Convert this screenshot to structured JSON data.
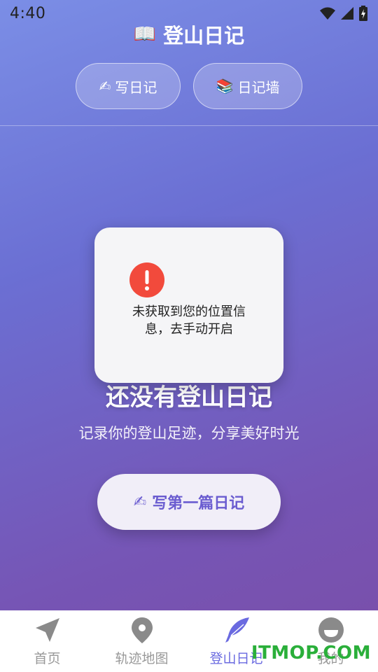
{
  "status_bar": {
    "time": "4:40"
  },
  "header": {
    "title": "登山日记",
    "tabs": [
      {
        "icon": "✍",
        "label": "写日记"
      },
      {
        "icon": "📚",
        "label": "日记墙"
      }
    ]
  },
  "dialog": {
    "message": "未获取到您的位置信息，去手动开启"
  },
  "empty_state": {
    "title": "还没有登山日记",
    "subtitle": "记录你的登山足迹，分享美好时光",
    "cta_icon": "✍",
    "cta_label": "写第一篇日记"
  },
  "bottom_nav": {
    "items": [
      {
        "label": "首页",
        "icon": "navigation-arrow-icon",
        "active": false
      },
      {
        "label": "轨迹地图",
        "icon": "map-pin-icon",
        "active": false
      },
      {
        "label": "登山日记",
        "icon": "feather-icon",
        "active": true
      },
      {
        "label": "我的",
        "icon": "profile-icon",
        "active": false
      }
    ]
  },
  "watermark": "ITMOP.COM",
  "colors": {
    "accent": "#6a6ae0",
    "alert": "#f24a3c",
    "watermark": "#2aaf3a"
  }
}
